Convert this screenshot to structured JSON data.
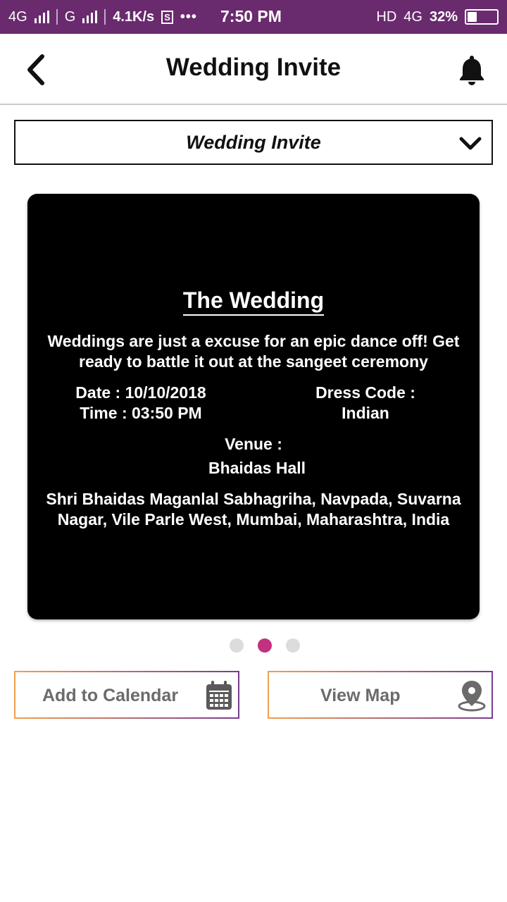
{
  "status_bar": {
    "net1": "4G",
    "net2": "G",
    "speed": "4.1K/s",
    "s_icon": "S",
    "more": "•••",
    "time": "7:50 PM",
    "hd": "HD",
    "net3": "4G",
    "battery": "32%",
    "battery_level": 0.32
  },
  "header": {
    "title": "Wedding Invite",
    "back_icon": "chevron-left-icon",
    "notification_icon": "bell-icon"
  },
  "dropdown": {
    "selected": "Wedding Invite",
    "icon": "chevron-down-icon"
  },
  "card": {
    "title": "The Wedding",
    "description": "Weddings are just a excuse for an epic dance off! Get ready to battle it out at the sangeet ceremony",
    "date": "Date : 10/10/2018",
    "time": "Time : 03:50 PM",
    "dress_code_label": "Dress Code :",
    "dress_code": "Indian",
    "venue_label": "Venue :",
    "venue_name": "Bhaidas Hall",
    "address": "Shri Bhaidas Maganlal Sabhagriha, Navpada, Suvarna Nagar, Vile Parle West, Mumbai, Maharashtra, India"
  },
  "pager": {
    "count": 3,
    "active_index": 1,
    "active_color": "#c0317f"
  },
  "actions": {
    "calendar_label": "Add to Calendar",
    "calendar_icon": "calendar-icon",
    "map_label": "View Map",
    "map_icon": "map-pin-icon"
  },
  "colors": {
    "status_bar": "#6a2a6e",
    "card_bg": "#000000",
    "gradient_start": "#f0a050",
    "gradient_end": "#7a3b8f"
  }
}
